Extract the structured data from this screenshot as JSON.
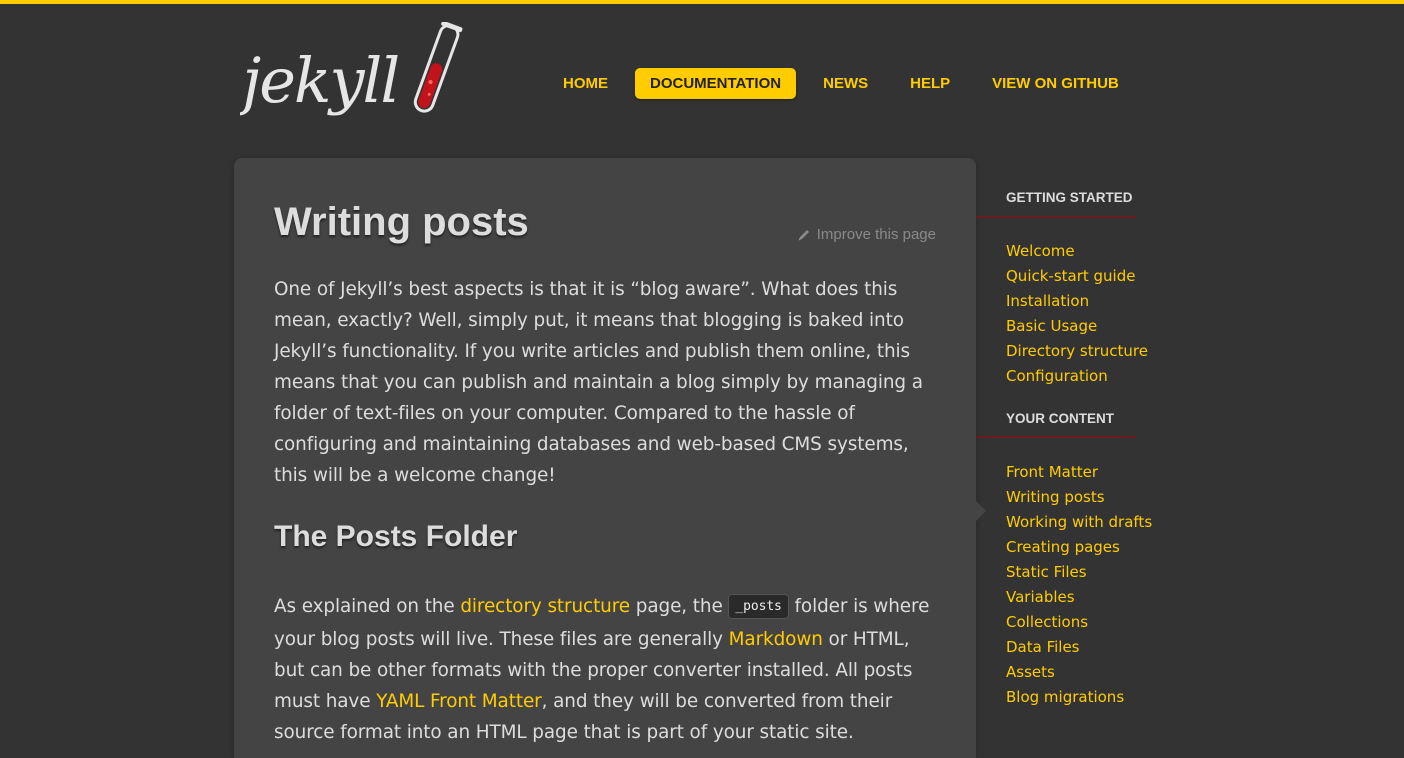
{
  "brand": {
    "logo_text": "jekyll"
  },
  "nav": {
    "items": [
      {
        "label": "HOME",
        "active": false
      },
      {
        "label": "DOCUMENTATION",
        "active": true
      },
      {
        "label": "NEWS",
        "active": false
      },
      {
        "label": "HELP",
        "active": false
      },
      {
        "label": "VIEW ON GITHUB",
        "active": false
      }
    ]
  },
  "article": {
    "title": "Writing posts",
    "improve_label": "Improve this page",
    "intro": "One of Jekyll’s best aspects is that it is “blog aware”. What does this mean, exactly? Well, simply put, it means that blogging is baked into Jekyll’s functionality. If you write articles and publish them online, this means that you can publish and maintain a blog simply by managing a folder of text-files on your computer. Compared to the hassle of configuring and maintaining databases and web-based CMS systems, this will be a welcome change!",
    "section_title": "The Posts Folder",
    "p2": {
      "t1": "As explained on the ",
      "link1": "directory structure",
      "t2": " page, the ",
      "code": "_posts",
      "t3": " folder is where your blog posts will live. These files are generally ",
      "link2": "Markdown",
      "t4": " or HTML, but can be other formats with the proper converter installed. All posts must have ",
      "link3": "YAML Front Matter",
      "t5": ", and they will be converted from their source format into an HTML page that is part of your static site."
    }
  },
  "sidebar": {
    "sections": [
      {
        "title": "GETTING STARTED",
        "items": [
          "Welcome",
          "Quick-start guide",
          "Installation",
          "Basic Usage",
          "Directory structure",
          "Configuration"
        ]
      },
      {
        "title": "YOUR CONTENT",
        "items": [
          "Front Matter",
          "Writing posts",
          "Working with drafts",
          "Creating pages",
          "Static Files",
          "Variables",
          "Collections",
          "Data Files",
          "Assets",
          "Blog migrations"
        ]
      }
    ]
  },
  "colors": {
    "accent": "#ffcc00",
    "background": "#333333",
    "panel": "#444444",
    "rule": "#aa0000"
  },
  "icons": {
    "improve": "pencil-icon",
    "logo_flask": "test-tube-icon"
  }
}
